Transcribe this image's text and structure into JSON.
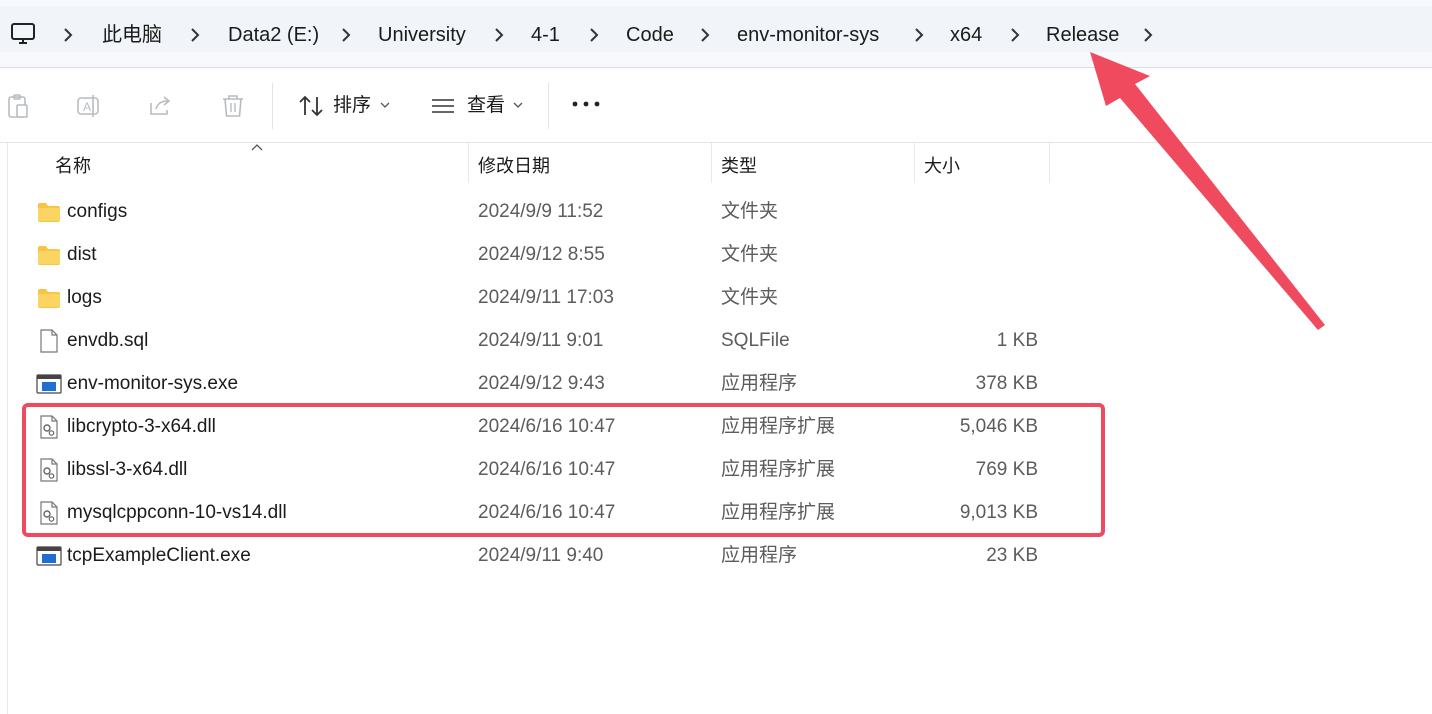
{
  "breadcrumb": {
    "items": [
      "此电脑",
      "Data2 (E:)",
      "University",
      "4-1",
      "Code",
      "env-monitor-sys",
      "x64",
      "Release"
    ]
  },
  "toolbar": {
    "sort_label": "排序",
    "view_label": "查看",
    "icons": [
      "paste-icon",
      "rename-icon",
      "share-icon",
      "delete-icon",
      "sort-icon",
      "view-icon",
      "more-icon"
    ]
  },
  "columns": {
    "name": "名称",
    "date": "修改日期",
    "type": "类型",
    "size": "大小"
  },
  "files": [
    {
      "name": "configs",
      "date": "2024/9/9 11:52",
      "type": "文件夹",
      "size": "",
      "icon": "folder-icon"
    },
    {
      "name": "dist",
      "date": "2024/9/12 8:55",
      "type": "文件夹",
      "size": "",
      "icon": "folder-icon"
    },
    {
      "name": "logs",
      "date": "2024/9/11 17:03",
      "type": "文件夹",
      "size": "",
      "icon": "folder-icon"
    },
    {
      "name": "envdb.sql",
      "date": "2024/9/11 9:01",
      "type": "SQLFile",
      "size": "1 KB",
      "icon": "file-icon"
    },
    {
      "name": "env-monitor-sys.exe",
      "date": "2024/9/12 9:43",
      "type": "应用程序",
      "size": "378 KB",
      "icon": "exe-icon"
    },
    {
      "name": "libcrypto-3-x64.dll",
      "date": "2024/6/16 10:47",
      "type": "应用程序扩展",
      "size": "5,046 KB",
      "icon": "dll-icon"
    },
    {
      "name": "libssl-3-x64.dll",
      "date": "2024/6/16 10:47",
      "type": "应用程序扩展",
      "size": "769 KB",
      "icon": "dll-icon"
    },
    {
      "name": "mysqlcppconn-10-vs14.dll",
      "date": "2024/6/16 10:47",
      "type": "应用程序扩展",
      "size": "9,013 KB",
      "icon": "dll-icon"
    },
    {
      "name": "tcpExampleClient.exe",
      "date": "2024/9/11 9:40",
      "type": "应用程序",
      "size": "23 KB",
      "icon": "exe-icon"
    }
  ],
  "colors": {
    "annotation": "#f04a5e",
    "folder": "#f8c542",
    "exe_accent": "#1e6fd0"
  }
}
